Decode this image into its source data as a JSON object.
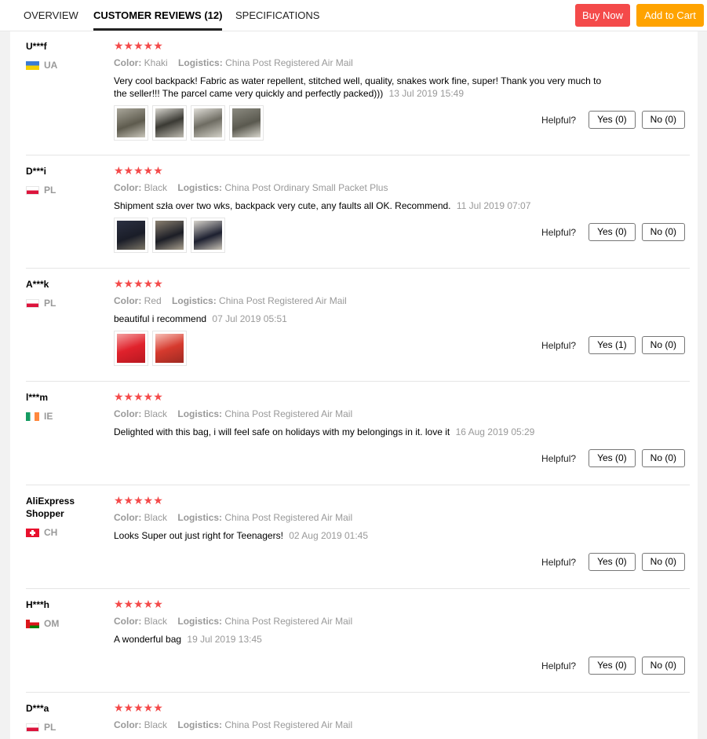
{
  "tabs": [
    {
      "label": "OVERVIEW"
    },
    {
      "label": "CUSTOMER REVIEWS (12)"
    },
    {
      "label": "SPECIFICATIONS"
    }
  ],
  "buttons": {
    "buy_now": "Buy Now",
    "add_to_cart": "Add to Cart"
  },
  "labels": {
    "color": "Color:",
    "logistics": "Logistics:",
    "helpful": "Helpful?"
  },
  "stars": "★★★★★",
  "reviews": [
    {
      "name": "U***f",
      "country": "UA",
      "flag": "ua-flag-icon",
      "rating": 5,
      "color": "Khaki",
      "logistics": "China Post Registered Air Mail",
      "text": "Very cool backpack! Fabric as water repellent, stitched well, quality, snakes work fine, super! Thank you very much to the seller!!! The parcel came very quickly and perfectly packed)))",
      "date": "13 Jul 2019 15:49",
      "yes": "Yes (0)",
      "no": "No (0)",
      "photos": 4
    },
    {
      "name": "D***i",
      "country": "PL",
      "flag": "pl-flag-icon",
      "rating": 5,
      "color": "Black",
      "logistics": "China Post Ordinary Small Packet Plus",
      "text": "Shipment szła over two wks, backpack very cute, any faults all OK. Recommend.",
      "date": "11 Jul 2019 07:07",
      "yes": "Yes (0)",
      "no": "No (0)",
      "photos": 3
    },
    {
      "name": "A***k",
      "country": "PL",
      "flag": "pl-flag-icon",
      "rating": 5,
      "color": "Red",
      "logistics": "China Post Registered Air Mail",
      "text": "beautiful i recommend",
      "date": "07 Jul 2019 05:51",
      "yes": "Yes (1)",
      "no": "No (0)",
      "photos": 2
    },
    {
      "name": "l***m",
      "country": "IE",
      "flag": "ie-flag-icon",
      "rating": 5,
      "color": "Black",
      "logistics": "China Post Registered Air Mail",
      "text": "Delighted with this bag, i will feel safe on holidays with my belongings in it. love it",
      "date": "16 Aug 2019 05:29",
      "yes": "Yes (0)",
      "no": "No (0)",
      "photos": 0
    },
    {
      "name": "AliExpress Shopper",
      "country": "CH",
      "flag": "ch-flag-icon",
      "rating": 5,
      "color": "Black",
      "logistics": "China Post Registered Air Mail",
      "text": "Looks Super out just right for Teenagers!",
      "date": "02 Aug 2019 01:45",
      "yes": "Yes (0)",
      "no": "No (0)",
      "photos": 0
    },
    {
      "name": "H***h",
      "country": "OM",
      "flag": "om-flag-icon",
      "rating": 5,
      "color": "Black",
      "logistics": "China Post Registered Air Mail",
      "text": "A wonderful bag",
      "date": "19 Jul 2019 13:45",
      "yes": "Yes (0)",
      "no": "No (0)",
      "photos": 0
    },
    {
      "name": "D***a",
      "country": "PL",
      "flag": "pl-flag-icon",
      "rating": 5,
      "color": "Black",
      "logistics": "China Post Registered Air Mail",
      "text": "",
      "date": "",
      "yes": "",
      "no": "",
      "photos": 0
    }
  ]
}
